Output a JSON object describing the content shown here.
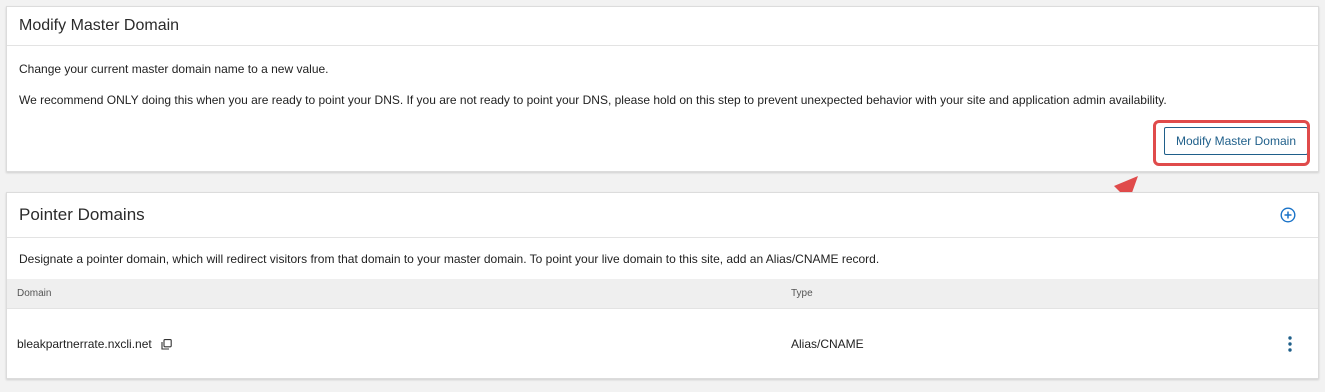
{
  "master_domain": {
    "title": "Modify Master Domain",
    "description_1": "Change your current master domain name to a new value.",
    "description_2": "We recommend ONLY doing this when you are ready to point your DNS. If you are not ready to point your DNS, please hold on this step to prevent unexpected behavior with your site and application admin availability.",
    "button_label": "Modify Master Domain"
  },
  "pointer_domains": {
    "title": "Pointer Domains",
    "description": "Designate a pointer domain, which will redirect visitors from that domain to your master domain. To point your live domain to this site, add an Alias/CNAME record.",
    "add_icon": "plus-circle-icon",
    "columns": [
      "Domain",
      "Type"
    ],
    "rows": [
      {
        "domain": "bleakpartnerrate.nxcli.net",
        "type": "Alias/CNAME"
      }
    ]
  },
  "colors": {
    "accent": "#1f5f8a",
    "annotation": "#e04b4b",
    "add_icon": "#1a73c8"
  }
}
